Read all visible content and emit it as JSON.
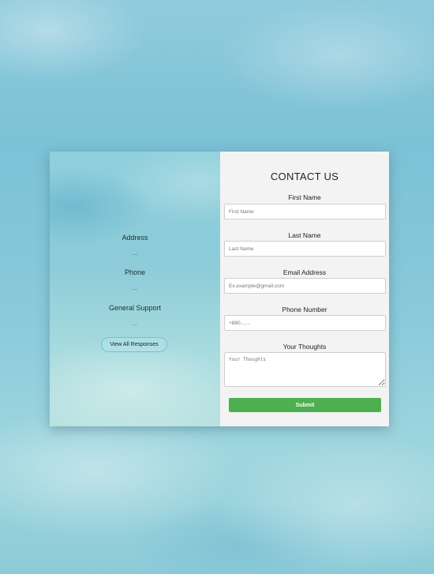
{
  "info": {
    "address_label": "Address",
    "address_value": "...",
    "phone_label": "Phone",
    "phone_value": "...",
    "support_label": "General Support",
    "support_value": "...",
    "responses_button": "View All Responses"
  },
  "form": {
    "title": "CONTACT US",
    "first_name": {
      "label": "First Name",
      "placeholder": "First Name",
      "value": ""
    },
    "last_name": {
      "label": "Last Name",
      "placeholder": "Last Name",
      "value": ""
    },
    "email": {
      "label": "Email Address",
      "placeholder": "Ex.example@gmail.com",
      "value": ""
    },
    "phone": {
      "label": "Phone Number",
      "placeholder": "+880.......",
      "value": ""
    },
    "thoughts": {
      "label": "Your Thoughts",
      "placeholder": "Your Thoughts",
      "value": ""
    },
    "submit_label": "Submit"
  },
  "colors": {
    "submit": "#4caf50",
    "responses_border": "#6ec3da",
    "form_background": "#f3f3f3"
  }
}
